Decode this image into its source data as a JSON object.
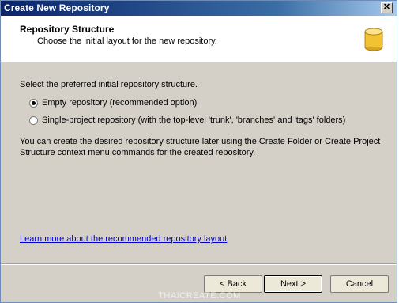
{
  "window": {
    "title": "Create New Repository"
  },
  "header": {
    "title": "Repository Structure",
    "subtitle": "Choose the initial layout for the new repository."
  },
  "main": {
    "prompt": "Select the preferred initial repository structure.",
    "options": [
      {
        "label": "Empty repository (recommended option)",
        "selected": true
      },
      {
        "label": "Single-project repository (with the top-level 'trunk', 'branches' and 'tags' folders)",
        "selected": false
      }
    ],
    "info_line1": "You can create the desired repository structure later using the Create Folder or Create Project",
    "info_line2": "Structure context menu commands for the created repository.",
    "learn_more_link": "Learn more about the recommended repository layout"
  },
  "buttons": {
    "back": "< Back",
    "next": "Next >",
    "cancel": "Cancel"
  },
  "watermark": "THAICREATE.COM",
  "colors": {
    "titlebar_start": "#0a246a",
    "titlebar_end": "#a6caf0",
    "dialog_bg": "#d4d0c8",
    "link": "#0000cc",
    "icon": "#f1c232"
  }
}
